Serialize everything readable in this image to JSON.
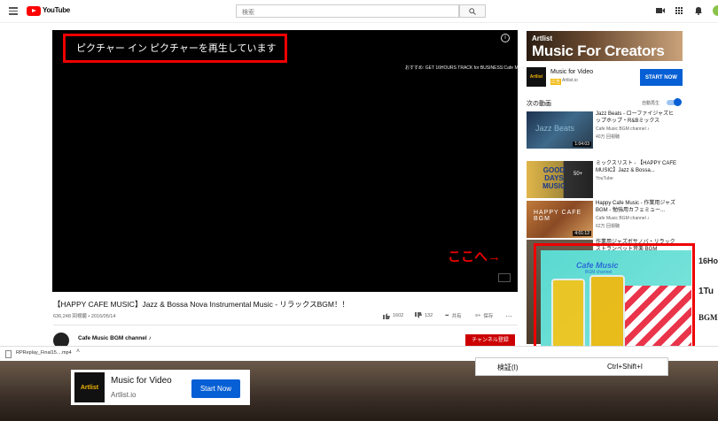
{
  "header": {
    "brand": "YouTube",
    "search_placeholder": "検索"
  },
  "player": {
    "pip_message": "ピクチャー イン ピクチャーを再生しています",
    "recommend_info": "おすすめ: GET 16HOURS TRACK for BUSINESS:Cafe Music Jazz & ..."
  },
  "video": {
    "title": "【HAPPY CAFE MUSIC】Jazz & Bossa Nova Instrumental Music - リラックスBGM！！",
    "meta": "636,248 回視聴 • 2016/05/14",
    "likes": "1602",
    "dislikes": "132",
    "share": "共有",
    "save": "保存",
    "channel": "Cafe Music BGM channel ♪",
    "subscribe": "チャンネル登録"
  },
  "ad": {
    "brand": "Artlist",
    "headline": "Music For Creators",
    "logo_text": "Artlist",
    "title": "Music for Video",
    "badge": "広告",
    "domain": "Artlist.io",
    "cta": "START NOW"
  },
  "sidebar": {
    "next_label": "次の動画",
    "autoplay_label": "自動再生"
  },
  "recommendations": [
    {
      "title": "Jazz Beats - ローファイジャズヒップホップ・R&Bミックス",
      "channel": "Cafe Music BGM channel ♪",
      "views": "40万 回視聴",
      "duration": "1:04:03",
      "thumb_text": "Jazz Beats"
    },
    {
      "title": "ミックスリスト - 【HAPPY CAFE MUSIC】Jazz & Bossa...",
      "channel": "YouTube",
      "views": "",
      "duration": "",
      "thumb_text": "GOOD DAYS MUSIC",
      "badge": "50+"
    },
    {
      "title": "Happy Cafe Music - 作業用ジャズBGM - 勉強用カフェミュー...",
      "channel": "Cafe Music BGM channel ♪",
      "views": "62万 回視聴",
      "duration": "4:01:12",
      "thumb_text": "HAPPY CAFE BGM"
    },
    {
      "title": "作業用ジャズボサノバ・リラックストランペット音楽 BGM",
      "channel": "",
      "views": "",
      "duration": "",
      "thumb_text": ""
    }
  ],
  "annotation": {
    "arrow_text": "ここへ→"
  },
  "pip_window": {
    "title": "Cafe Music",
    "subtitle": "BGM channel",
    "side_text": "16Ho",
    "side_text2": "1Tu",
    "side_text3": "BGM"
  },
  "download": {
    "filename": "RPReplay_Final15....mp4"
  },
  "context_menu": {
    "item": "検証(I)",
    "shortcut": "Ctrl+Shift+I"
  },
  "bottom_ad": {
    "logo_text": "Artlist",
    "title": "Music for Video",
    "domain": "Artlist.io",
    "cta": "Start Now"
  }
}
